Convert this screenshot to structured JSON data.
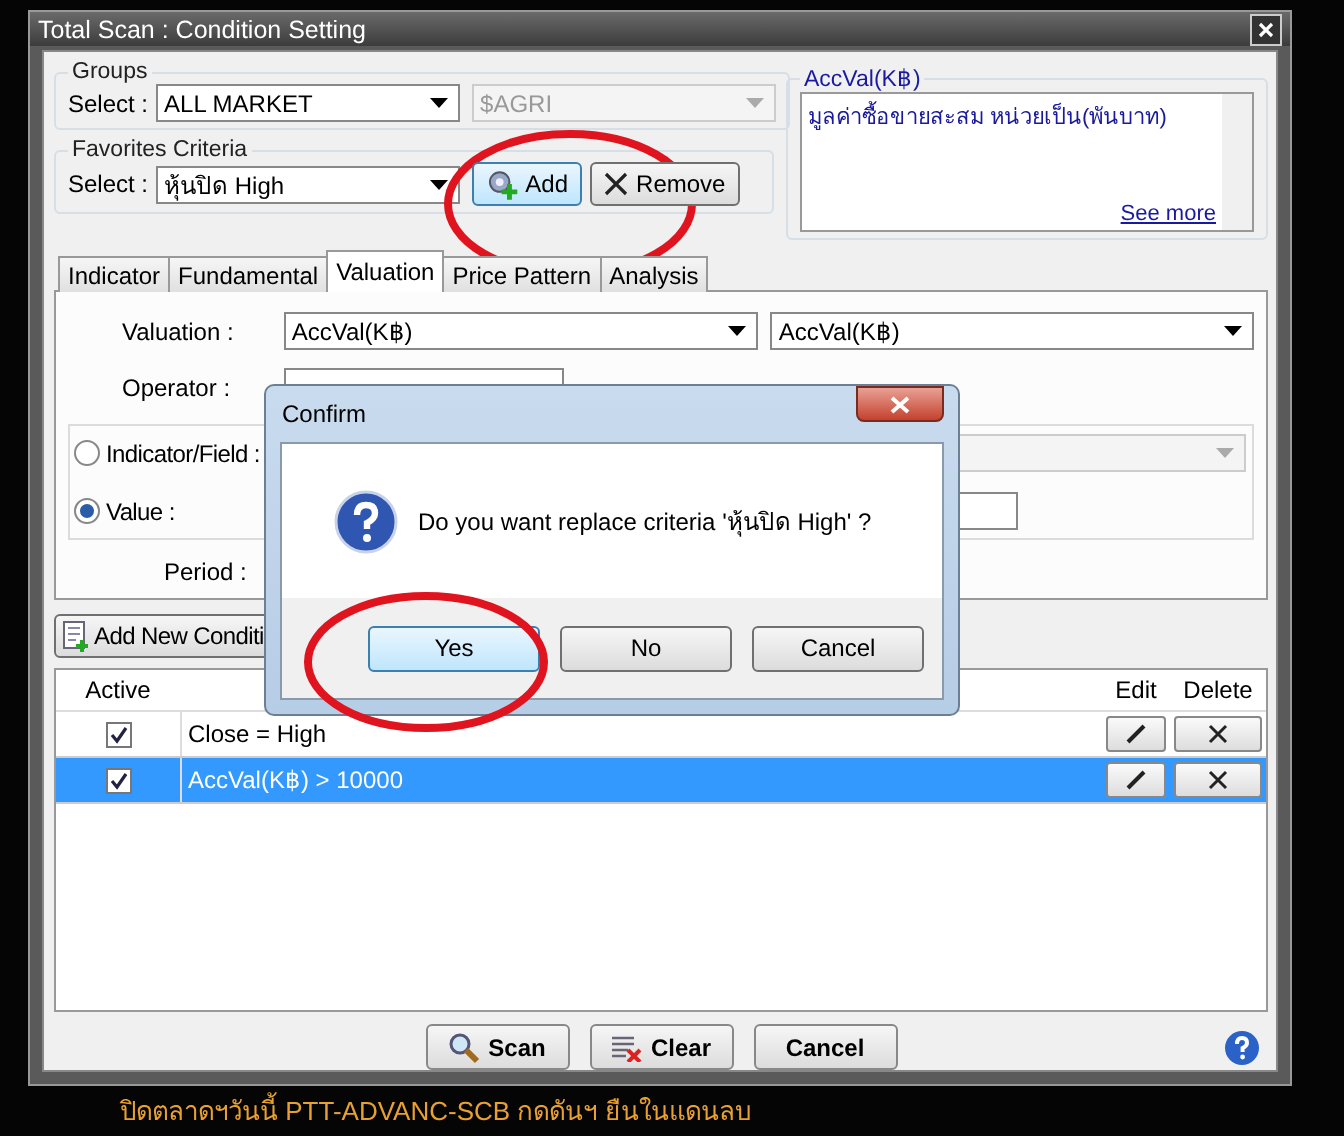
{
  "window": {
    "title": "Total Scan : Condition Setting"
  },
  "groups": {
    "label": "Groups",
    "select_label": "Select :",
    "group": "ALL MARKET",
    "subgroup": "$AGRI",
    "subgroup_disabled": true
  },
  "favorites": {
    "label": "Favorites Criteria",
    "select_label": "Select :",
    "value": "หุ้นปิด High",
    "add": "Add",
    "remove": "Remove"
  },
  "description": {
    "title": "AccVal(K฿)",
    "text": "มูลค่าซื้อขายสะสม หน่วยเป็น(พันบาท)",
    "link": "See more"
  },
  "tabs": [
    {
      "label": "Indicator",
      "selected": false
    },
    {
      "label": "Fundamental",
      "selected": false
    },
    {
      "label": "Valuation",
      "selected": true
    },
    {
      "label": "Price Pattern",
      "selected": false
    },
    {
      "label": "Analysis",
      "selected": false
    }
  ],
  "valuation": {
    "label": "Valuation :",
    "field": "AccVal(K฿)",
    "field_2": "AccVal(K฿)",
    "operator_label": "Operator :",
    "period_label": "Period :",
    "sources": [
      {
        "label": "Indicator/Field :",
        "selected": false
      },
      {
        "label": "Value :",
        "selected": true
      }
    ]
  },
  "add_condition": "Add New Conditi",
  "conditions": {
    "columns": [
      "Active",
      "Edit",
      "Delete"
    ],
    "rows": [
      {
        "active": true,
        "text": "Close = High",
        "selected": false
      },
      {
        "active": true,
        "text": "AccVal(K฿) > 10000",
        "selected": true
      }
    ]
  },
  "buttons": [
    {
      "kind": "scan",
      "label": "Scan"
    },
    {
      "kind": "clear",
      "label": "Clear"
    },
    {
      "kind": "cancel",
      "label": "Cancel"
    }
  ],
  "confirm": {
    "title": "Confirm",
    "message": "Do you want replace criteria 'หุ้นปิด High' ?",
    "buttons": [
      {
        "label": "Yes",
        "selected": true
      },
      {
        "label": "No",
        "selected": false
      },
      {
        "label": "Cancel",
        "selected": false
      }
    ]
  },
  "ticker": "ปิดตลาดฯวันนี้ PTT-ADVANC-SCB กดดันฯ ยืนในแดนลบ"
}
